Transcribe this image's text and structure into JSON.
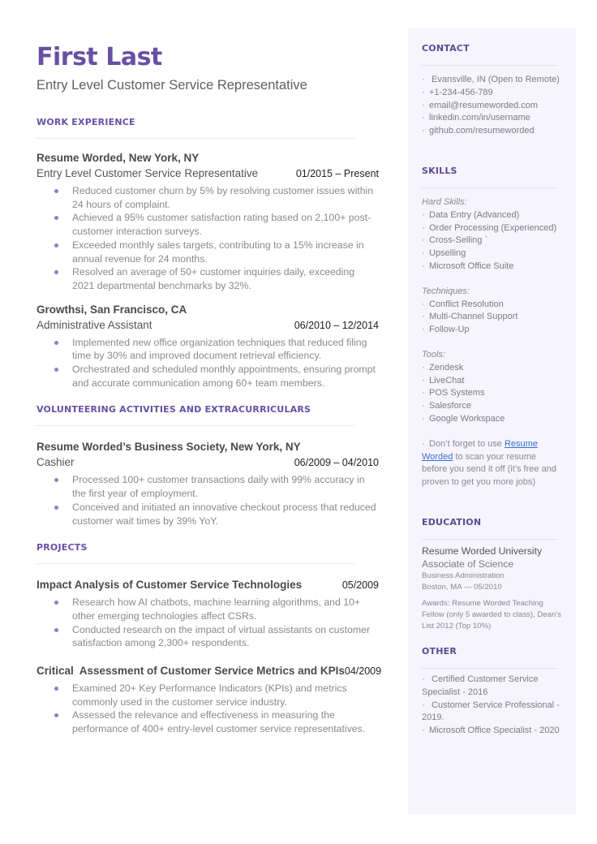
{
  "header": {
    "name": "First Last",
    "headline": "Entry Level Customer Service Representative"
  },
  "colors": {
    "accent": "#6750a4",
    "sidebar_bg": "#f6f4fd",
    "bullet": "#8c7fc4",
    "link": "#3b6fcf"
  },
  "work": {
    "title": "WORK EXPERIENCE",
    "entries": [
      {
        "org": "Resume Worded, New York, NY",
        "role": "Entry Level Customer Service Representative",
        "date": "01/2015 – Present",
        "bullets": [
          "Reduced customer churn by 5% by resolving customer issues within 24 hours of complaint.",
          "Achieved a 95% customer satisfaction rating based on 2,100+ post-customer interaction surveys.",
          "Exceeded monthly sales targets, contributing to a 15% increase in annual revenue for 24 months.",
          "Resolved an average of 50+ customer inquiries daily, exceeding 2021 departmental benchmarks by 32%."
        ]
      },
      {
        "org": "Growthsi, San Francisco, CA",
        "role": "Administrative Assistant",
        "date": "06/2010 – 12/2014",
        "bullets": [
          "Implemented new office organization techniques that reduced filing time by 30% and improved document retrieval efficiency.",
          "Orchestrated and scheduled monthly appointments, ensuring prompt and accurate communication among 60+ team members."
        ]
      }
    ]
  },
  "volunteering": {
    "title": "VOLUNTEERING ACTIVITIES AND EXTRACURRICULARS",
    "entries": [
      {
        "org": "Resume Worded’s Business Society, New York, NY",
        "role": "Cashier",
        "date": "06/2009 – 04/2010",
        "bullets": [
          "Processed 100+ customer transactions daily with 99% accuracy in the first year of employment.",
          "Conceived and initiated an innovative checkout process that reduced customer wait times by 39% YoY."
        ]
      }
    ]
  },
  "projects": {
    "title": "PROJECTS",
    "entries": [
      {
        "title": "Impact Analysis of Customer Service Technologies",
        "date": "05/2009",
        "bullets": [
          "Research how AI chatbots, machine learning algorithms, and 10+ other emerging technologies affect CSRs.",
          "Conducted research on the impact of virtual assistants on customer satisfaction among 2,300+ respondents."
        ]
      },
      {
        "title": "Critical  Assessment of Customer Service Metrics and KPIs",
        "date": "04/2009",
        "bullets": [
          "Examined 20+ Key Performance Indicators (KPIs) and metrics commonly used in the customer service industry.",
          "Assessed the relevance and effectiveness in measuring the performance of 400+ entry-level customer service representatives."
        ]
      }
    ]
  },
  "sidebar": {
    "contact": {
      "title": "CONTACT",
      "items": [
        " Evansville, IN (Open to Remote)",
        "+1-234-456-789",
        "email@resumeworded.com",
        "linkedin.com/in/username",
        "github.com/resumeworded"
      ]
    },
    "skills": {
      "title": "SKILLS",
      "groups": [
        {
          "label": "Hard Skills:",
          "items": [
            "Data Entry (Advanced)",
            "Order Processing (Experienced)",
            "Cross-Selling `",
            "Upselling",
            "Microsoft Office Suite"
          ]
        },
        {
          "label": "Techniques:",
          "items": [
            "Conflict Resolution",
            "Multi-Channel Support",
            "Follow-Up"
          ]
        },
        {
          "label": "Tools:",
          "items": [
            "Zendesk",
            "LiveChat",
            "POS Systems",
            "Salesforce",
            "Google Workspace"
          ]
        }
      ],
      "note_prefix": "Don’t forget to use ",
      "note_link": "Resume Worded",
      "note_suffix": " to scan your resume before you send it off (it’s free and proven to get you more jobs)"
    },
    "education": {
      "title": "EDUCATION",
      "school": "Resume Worded University",
      "degree": "Associate of Science",
      "field": "Business Administration",
      "location_date": "Boston, MA — 05/2010",
      "awards": "Awards: Resume Worded Teaching Fellow (only 5 awarded to class), Dean’s List 2012 (Top 10%)"
    },
    "other": {
      "title": "OTHER",
      "items": [
        " Certified Customer Service Specialist - 2016",
        " Customer Service Professional  - 2019.",
        "Microsoft Office Specialist - 2020"
      ]
    }
  }
}
